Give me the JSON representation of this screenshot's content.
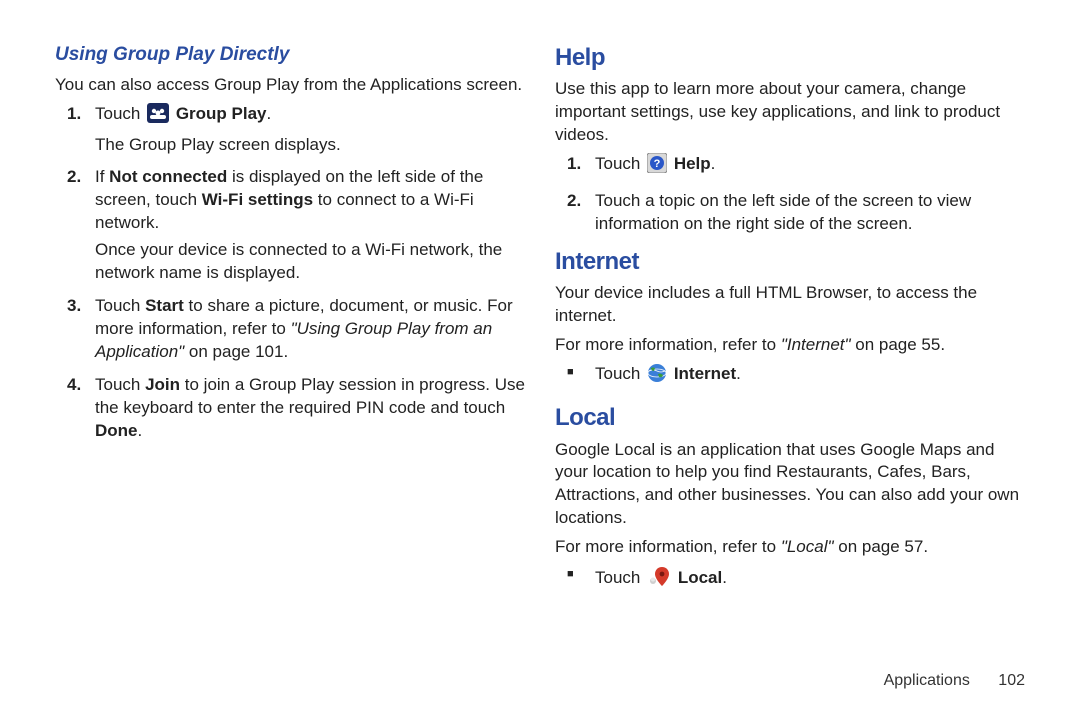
{
  "left": {
    "subheading": "Using Group Play Directly",
    "intro": "You can also access Group Play from the Applications screen.",
    "steps": [
      {
        "pre": "Touch ",
        "icon": "group-play-icon",
        "post": " ",
        "bold": "Group Play",
        "tail": ".",
        "sub": "The Group Play screen displays."
      },
      {
        "line1_pre": "If ",
        "line1_b1": "Not connected",
        "line1_mid": " is displayed on the left side of the screen, touch ",
        "line1_b2": "Wi-Fi settings",
        "line1_tail": " to connect to a Wi-Fi network.",
        "sub": "Once your device is connected to a Wi-Fi network, the network name is displayed."
      },
      {
        "pre": "Touch ",
        "b1": "Start",
        "mid": " to share a picture, document, or music. For more information, refer to ",
        "ref_italic": "\"Using Group Play from an Application\"",
        "tail": " on page 101."
      },
      {
        "pre": "Touch ",
        "b1": "Join",
        "mid": " to join a Group Play session in progress. Use the keyboard to enter the required PIN code and touch ",
        "b2": "Done",
        "tail": "."
      }
    ]
  },
  "right": {
    "help": {
      "heading": "Help",
      "intro": "Use this app to learn more about your camera, change important settings, use key applications, and link to product videos.",
      "step1_pre": "Touch ",
      "step1_bold": "Help",
      "step1_tail": ".",
      "step2": "Touch a topic on the left side of the screen to view information on the right side of the screen."
    },
    "internet": {
      "heading": "Internet",
      "intro": "Your device includes a full HTML Browser, to access the internet.",
      "ref_pre": "For more information, refer to ",
      "ref_italic": "\"Internet\"",
      "ref_tail": " on page 55.",
      "bullet_pre": "Touch ",
      "bullet_bold": "Internet",
      "bullet_tail": "."
    },
    "local": {
      "heading": "Local",
      "intro": "Google Local is an application that uses Google Maps and your location to help you find Restaurants, Cafes, Bars, Attractions, and other businesses. You can also add your own locations.",
      "ref_pre": "For more information, refer to ",
      "ref_italic": "\"Local\"",
      "ref_tail": " on page 57.",
      "bullet_pre": "Touch ",
      "bullet_bold": "Local",
      "bullet_tail": "."
    }
  },
  "footer": {
    "section": "Applications",
    "page": "102"
  }
}
